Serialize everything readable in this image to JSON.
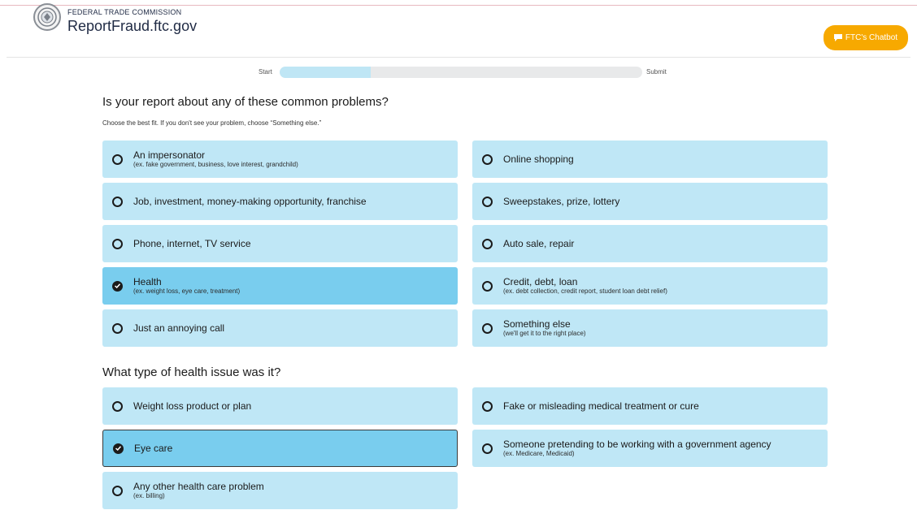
{
  "header": {
    "agency": "FEDERAL TRADE COMMISSION",
    "site": "ReportFraud.ftc.gov",
    "seal_icon": "ftc-seal-icon",
    "chatbot_label": "FTC's Chatbot",
    "chatbot_icon": "chat-bubble-icon",
    "accent_color": "#f7a900"
  },
  "progress": {
    "start_label": "Start",
    "end_label": "Submit",
    "fraction": 0.25
  },
  "q1": {
    "heading": "Is your report about any of these common problems?",
    "hint": "Choose the best fit. If you don't see your problem, choose “Something else.”",
    "options": [
      {
        "label": "An impersonator",
        "sub": "(ex. fake government, business, love interest, grandchild)",
        "selected": false
      },
      {
        "label": "Online shopping",
        "sub": "",
        "selected": false
      },
      {
        "label": "Job, investment, money-making opportunity, franchise",
        "sub": "",
        "selected": false
      },
      {
        "label": "Sweepstakes, prize, lottery",
        "sub": "",
        "selected": false
      },
      {
        "label": "Phone, internet, TV service",
        "sub": "",
        "selected": false
      },
      {
        "label": "Auto sale, repair",
        "sub": "",
        "selected": false
      },
      {
        "label": "Health",
        "sub": "(ex. weight loss, eye care, treatment)",
        "selected": true
      },
      {
        "label": "Credit, debt, loan",
        "sub": "(ex. debt collection, credit report, student loan debt relief)",
        "selected": false
      },
      {
        "label": "Just an annoying call",
        "sub": "",
        "selected": false
      },
      {
        "label": "Something else",
        "sub": "(we'll get it to the right place)",
        "selected": false
      }
    ]
  },
  "q2": {
    "heading": "What type of health issue was it?",
    "options": [
      {
        "label": "Weight loss product or plan",
        "sub": "",
        "selected": false
      },
      {
        "label": "Fake or misleading medical treatment or cure",
        "sub": "",
        "selected": false
      },
      {
        "label": "Eye care",
        "sub": "",
        "selected": true
      },
      {
        "label": "Someone pretending to be working with a government agency",
        "sub": "(ex. Medicare, Medicaid)",
        "selected": false
      },
      {
        "label": "Any other health care problem",
        "sub": "(ex. billing)",
        "selected": false
      }
    ]
  },
  "colors": {
    "option_bg": "#bfe7f6",
    "option_selected_bg": "#79cdee",
    "progress_fill": "#bfe6f5",
    "progress_track": "#e8e9ea"
  }
}
